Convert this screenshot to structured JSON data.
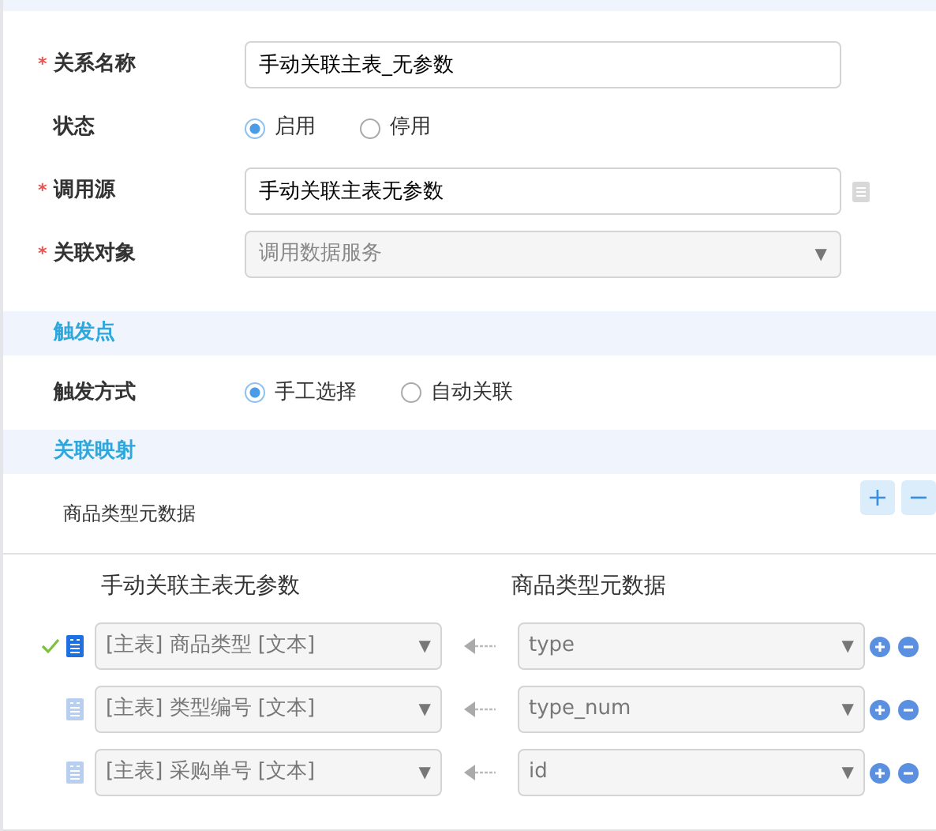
{
  "basic": [
    {
      "kind": "input",
      "label": "关系名称",
      "required_mark": "*",
      "value": "手动关联主表_无参数"
    },
    {
      "kind": "radio",
      "label": "状态",
      "options": [
        {
          "label": "启用",
          "selected": true
        },
        {
          "label": "停用",
          "selected": false
        }
      ]
    },
    {
      "kind": "input",
      "label": "调用源",
      "required_mark": "*",
      "value": "手动关联主表无参数",
      "doc_icon": true
    },
    {
      "kind": "select",
      "label": "关联对象",
      "required_mark": "*",
      "value": "调用数据服务",
      "caret": "▼"
    }
  ],
  "trigger": {
    "title": "触发点",
    "label": "触发方式",
    "options": [
      {
        "label": "手工选择",
        "selected": true
      },
      {
        "label": "自动关联",
        "selected": false
      }
    ]
  },
  "mapping": {
    "title": "关联映射",
    "source_name": "商品类型元数据",
    "add": "+",
    "remove": "−",
    "left_header": "手动关联主表无参数",
    "right_header": "商品类型元数据",
    "rows": [
      {
        "selected": true,
        "left": "[主表] 商品类型 [文本]",
        "left_caret": "▼",
        "right": "type",
        "right_caret": "▼"
      },
      {
        "selected": false,
        "left": "[主表] 类型编号 [文本]",
        "left_caret": "▼",
        "right": "type_num",
        "right_caret": "▼"
      },
      {
        "selected": false,
        "left": "[主表] 采购单号 [文本]",
        "left_caret": "▼",
        "right": "id",
        "right_caret": "▼"
      }
    ]
  }
}
